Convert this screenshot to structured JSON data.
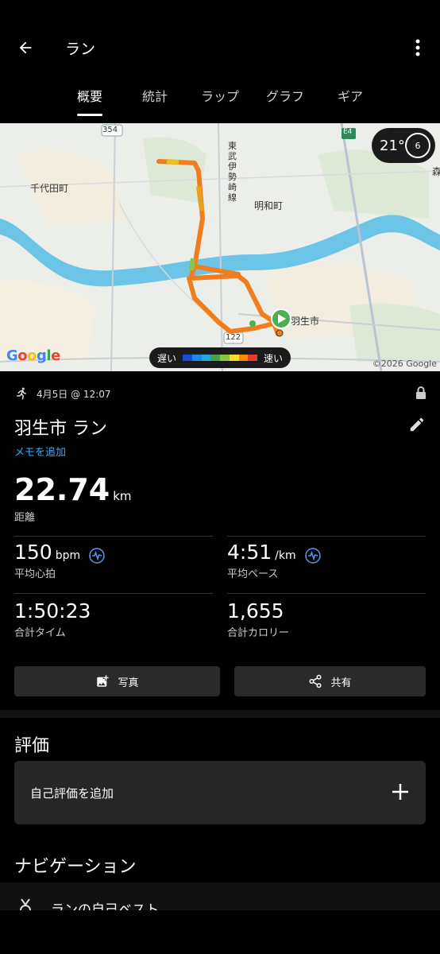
{
  "header": {
    "title": "ラン"
  },
  "tabs": [
    {
      "label": "概要",
      "active": true
    },
    {
      "label": "統計"
    },
    {
      "label": "ラップ"
    },
    {
      "label": "グラフ"
    },
    {
      "label": "ギア"
    }
  ],
  "map": {
    "labels": {
      "chiyoda": "千代田町",
      "meiwa": "明和町",
      "hanyu": "羽生市",
      "railway": "東武伊勢崎線",
      "road354": "354",
      "road122": "122",
      "e4": "E4",
      "edge": "森"
    },
    "weather": {
      "temp": "21°",
      "wind": "6"
    },
    "legend": {
      "slow": "遅い",
      "fast": "速い"
    },
    "google": "Google",
    "copyright": "©2026 Google",
    "colors": {
      "route_fast": "#f07d1e",
      "route_slow": "#e8a020",
      "start_pin": "#4caf50",
      "river": "#6cc5e6"
    }
  },
  "activity": {
    "date": "4月5日 @ 12:07",
    "title": "羽生市 ラン",
    "memo_link": "メモを追加",
    "distance": {
      "value": "22.74",
      "unit": "km",
      "label": "距離"
    },
    "heart": {
      "value": "150",
      "unit": "bpm",
      "label": "平均心拍"
    },
    "pace": {
      "value": "4:51",
      "unit": "/km",
      "label": "平均ペース"
    },
    "time": {
      "value": "1:50:23",
      "label": "合計タイム"
    },
    "calories": {
      "value": "1,655",
      "label": "合計カロリー"
    }
  },
  "buttons": {
    "photo": "写真",
    "share": "共有"
  },
  "rating": {
    "title": "評価",
    "add": "自己評価を追加"
  },
  "navigation": {
    "title": "ナビゲーション",
    "item": "ランの自己ベスト"
  },
  "icons": [
    "back-arrow-icon",
    "more-vert-icon",
    "run-icon",
    "lock-icon",
    "edit-pencil-icon",
    "heart-wave-icon",
    "photo-add-icon",
    "share-icon",
    "plus-icon",
    "medal-icon"
  ]
}
